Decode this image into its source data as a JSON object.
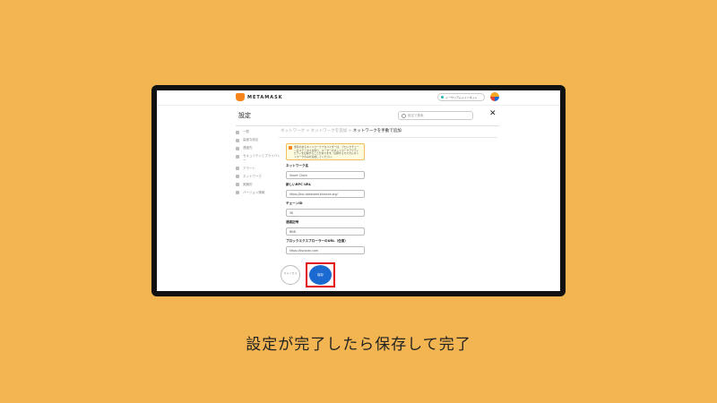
{
  "app": {
    "brand": "METAMASK",
    "network": "イーサリアムメインネット",
    "avatar_colors": [
      "#f5a623",
      "#1b6ad2",
      "#e0413b"
    ]
  },
  "header": {
    "title": "設定",
    "search_placeholder": "設定で検索"
  },
  "sidebar": {
    "items": [
      {
        "label": "一般",
        "icon": "gear-icon"
      },
      {
        "label": "高度な設定",
        "icon": "sliders-icon"
      },
      {
        "label": "連絡先",
        "icon": "book-icon"
      },
      {
        "label": "セキュリティとプライバシー",
        "icon": "lock-icon"
      },
      {
        "label": "アラート",
        "icon": "bell-icon"
      },
      {
        "label": "ネットワーク",
        "icon": "network-icon"
      },
      {
        "label": "実験的",
        "icon": "flask-icon"
      },
      {
        "label": "バージョン情報",
        "icon": "info-icon"
      }
    ]
  },
  "main": {
    "breadcrumb_prev": "ネットワーク > ネットワークを追加 > ",
    "breadcrumb_current": "ネットワークを手動で追加",
    "warning_text": "悪意のあるネットワークプロバイダーは、ブロックチェーンのステータスを偽り、ユーザーのネットワークアクティビティを記録することがあります。信頼するカスタムネットワークのみを追加してください。",
    "fields": [
      {
        "label": "ネットワーク名",
        "value": "Smart Chain"
      },
      {
        "label": "新しいRPC URL",
        "value": "https://bsc-dataseed.binance.org/"
      },
      {
        "label": "チェーンID",
        "value": "56"
      },
      {
        "label": "通貨記号",
        "value": "BNB"
      },
      {
        "label": "ブロックエクスプローラーのURL（任意）",
        "value": "https://bscscan.com"
      }
    ],
    "cancel_label": "キャンセル",
    "save_label": "保存"
  },
  "caption": "設定が完了したら保存して完了",
  "colors": {
    "background": "#f2b552",
    "accent": "#1b6ad2",
    "highlight": "#e30613"
  }
}
